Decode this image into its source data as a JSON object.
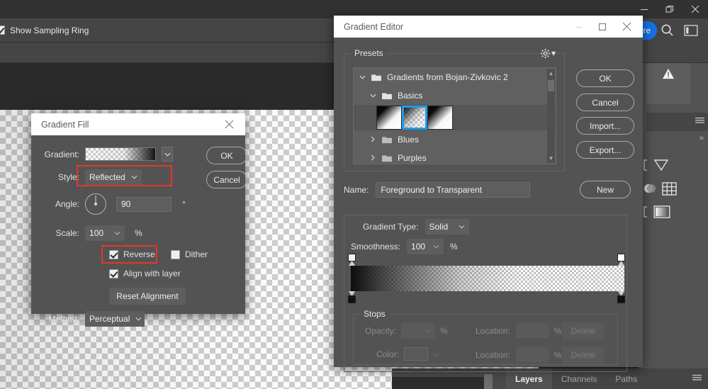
{
  "app": {
    "window_controls": [
      "minimize",
      "restore",
      "close"
    ],
    "options_bar": {
      "show_sampling_ring_label": "Show Sampling Ring",
      "show_sampling_ring_checked": true
    },
    "right_dock": {
      "share_label": "re",
      "search_icon": "search-icon",
      "workspace_icon": "workspace-icon",
      "expand_label": "»",
      "warning_icon": "warning-triangle-icon",
      "panel_menu_icon": "panel-menu-icon",
      "icons": [
        "gradient-triangle-icon",
        "adjustments-icon",
        "grid-icon",
        "gradient-map-icon"
      ]
    },
    "bottom_panel": {
      "tabs": [
        {
          "label": "Layers",
          "active": true
        },
        {
          "label": "Channels",
          "active": false
        },
        {
          "label": "Paths",
          "active": false
        }
      ],
      "menu_icon": "panel-menu-icon"
    }
  },
  "gradient_fill": {
    "title": "Gradient Fill",
    "close_icon": "close-icon",
    "gradient_label": "Gradient:",
    "gradient_dropdown_icon": "chevron-down-icon",
    "style_label": "Style:",
    "style_value": "Reflected",
    "angle_label": "Angle:",
    "angle_value": "90",
    "angle_unit": "°",
    "scale_label": "Scale:",
    "scale_value": "100",
    "scale_unit": "%",
    "reverse_label": "Reverse",
    "reverse_checked": true,
    "dither_label": "Dither",
    "dither_checked": false,
    "align_label": "Align with layer",
    "align_checked": true,
    "reset_alignment_label": "Reset Alignment",
    "method_label": "Method:",
    "method_value": "Perceptual",
    "ok_label": "OK",
    "cancel_label": "Cancel",
    "highlight_color": "#e8352a"
  },
  "gradient_editor": {
    "title": "Gradient Editor",
    "minimize_icon": "minimize-icon",
    "maximize_icon": "maximize-icon",
    "close_icon": "close-icon",
    "presets_label": "Presets",
    "presets_gear_icon": "gear-icon",
    "tree": [
      {
        "label": "Gradients from Bojan-Zivkovic 2",
        "expanded": true,
        "depth": 0
      },
      {
        "label": "Basics",
        "expanded": true,
        "depth": 1
      }
    ],
    "thumbnails": [
      {
        "name": "black-to-white",
        "selected": false
      },
      {
        "name": "foreground-to-transparent",
        "selected": true
      },
      {
        "name": "black-to-white-2",
        "selected": false
      }
    ],
    "tree_collapsed": [
      {
        "label": "Blues",
        "expanded": false,
        "depth": 1
      },
      {
        "label": "Purples",
        "expanded": false,
        "depth": 1
      }
    ],
    "name_label": "Name:",
    "name_value": "Foreground to Transparent",
    "new_label": "New",
    "gradient_type_label": "Gradient Type:",
    "gradient_type_value": "Solid",
    "smoothness_label": "Smoothness:",
    "smoothness_value": "100",
    "smoothness_unit": "%",
    "stops_label": "Stops",
    "opacity_label": "Opacity:",
    "opacity_value": "",
    "opacity_unit": "%",
    "color_label": "Color:",
    "location_label_1": "Location:",
    "location_value_1": "",
    "location_unit_1": "%",
    "location_label_2": "Location:",
    "location_value_2": "",
    "location_unit_2": "%",
    "delete_label_1": "Delete",
    "delete_label_2": "Delete",
    "ok_label": "OK",
    "cancel_label": "Cancel",
    "import_label": "Import...",
    "export_label": "Export...",
    "accent_color": "#1f9ae8"
  }
}
